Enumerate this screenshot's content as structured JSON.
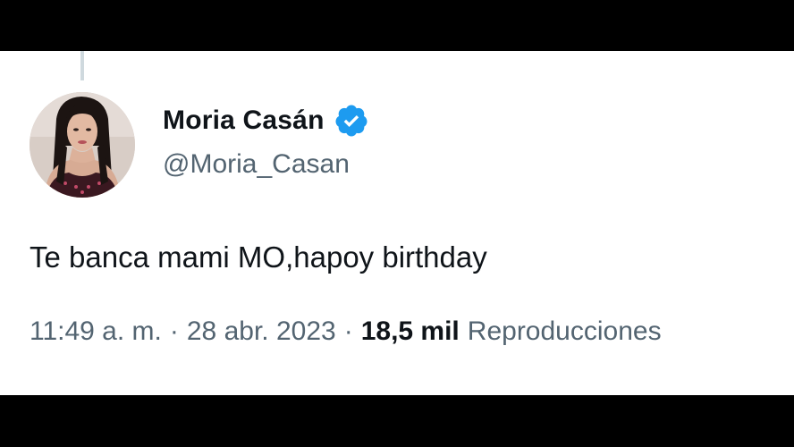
{
  "tweet": {
    "author": {
      "display_name": "Moria Casán",
      "handle": "@Moria_Casan",
      "verified": true,
      "verified_badge_color": "#1d9bf0"
    },
    "text": "Te banca mami MO,hapoy birthday",
    "meta": {
      "time": "11:49 a. m.",
      "separator": "·",
      "date": "28 abr. 2023",
      "views_count": "18,5 mil",
      "views_label": "Reproducciones"
    }
  },
  "colors": {
    "text_primary": "#0f1419",
    "text_secondary": "#536471",
    "thread_line": "#cfd9de",
    "background": "#ffffff"
  }
}
